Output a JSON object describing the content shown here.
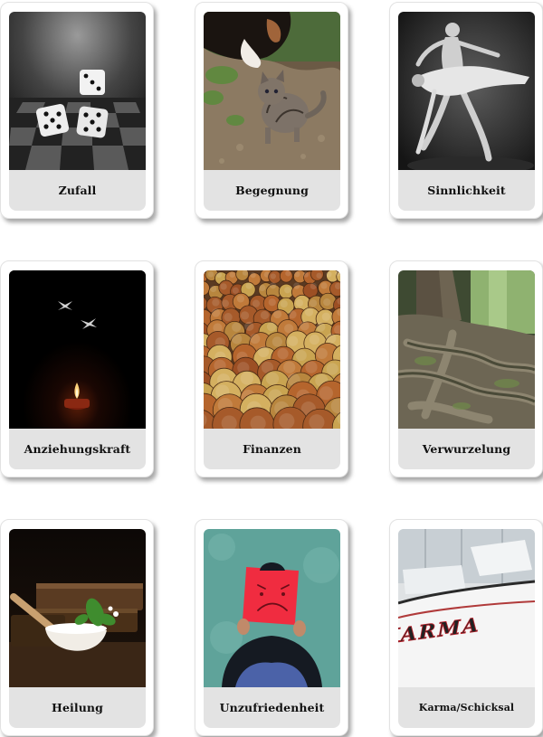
{
  "cards": [
    {
      "label": "Zufall",
      "image": "dice-photo"
    },
    {
      "label": "Begegnung",
      "image": "kitten-and-dog-photo"
    },
    {
      "label": "Sinnlichkeit",
      "image": "dancers-photo"
    },
    {
      "label": "Anziehungskraft",
      "image": "moths-candle-photo"
    },
    {
      "label": "Finanzen",
      "image": "coins-photo"
    },
    {
      "label": "Verwurzelung",
      "image": "tree-roots-photo"
    },
    {
      "label": "Heilung",
      "image": "mortar-herbs-photo"
    },
    {
      "label": "Unzufriedenheit",
      "image": "sad-face-sign-photo"
    },
    {
      "label": "Karma/Schicksal",
      "image": "karma-boat-photo",
      "boat_text": "KARMA"
    }
  ]
}
